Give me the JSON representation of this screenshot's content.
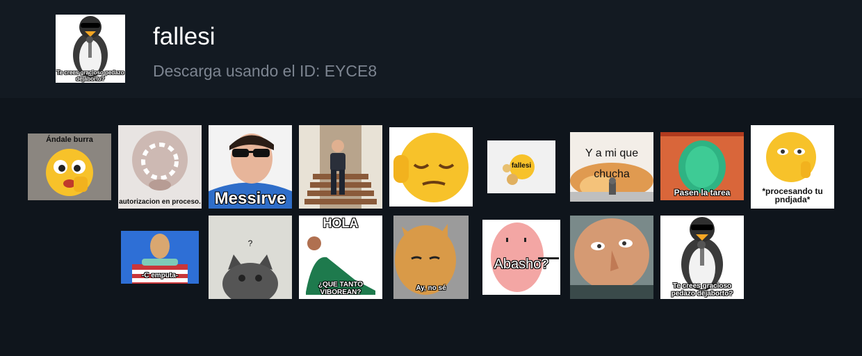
{
  "pack": {
    "title": "fallesi",
    "subtitle": "Descarga usando el ID: EYCE8",
    "cover_caption": "Te crees gracioso pedazo dejaborto?"
  },
  "stickers": [
    {
      "caption": "Ándale burra"
    },
    {
      "caption": "autorizacion en proceso."
    },
    {
      "caption": "Messirve"
    },
    {
      "caption": ""
    },
    {
      "caption": ""
    },
    {
      "caption": "fallesi"
    },
    {
      "caption": "Y a mi que chucha"
    },
    {
      "caption": "Pasen la tarea"
    },
    {
      "caption": "*procesando tu pndjada*"
    },
    {
      "caption": "-C emputa-"
    },
    {
      "caption": "?"
    },
    {
      "caption": "HOLA",
      "caption2": "¿QUE TANTO VIBOREAN?"
    },
    {
      "caption": "Ay, no sé"
    },
    {
      "caption": "Abasho?"
    },
    {
      "caption": ""
    },
    {
      "caption": "Te crees gracioso pedazo dejaborto?"
    }
  ],
  "colors": {
    "page_bg": "#0f151c",
    "header_bg": "#131a22",
    "title": "#ffffff",
    "subtitle": "#7c8490",
    "emoji_yellow": "#f7c22a"
  }
}
